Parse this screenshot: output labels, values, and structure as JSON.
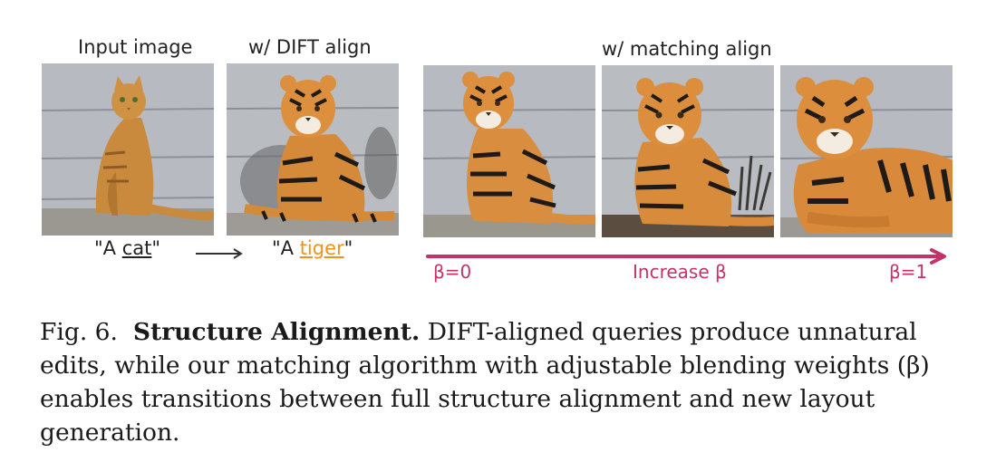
{
  "figure": {
    "headers": {
      "input": "Input image",
      "dift": "w/ DIFT align",
      "matching": "w/ matching align"
    },
    "prompts": {
      "source_prefix": "\"A ",
      "source_word": "cat",
      "source_suffix": "\"",
      "target_prefix": "\"A ",
      "target_word": "tiger",
      "target_suffix": "\""
    },
    "beta_axis": {
      "start": "β=0",
      "middle": "Increase β",
      "end": "β=1"
    },
    "colors": {
      "accent_pink": "#c2336a",
      "accent_orange": "#f0921e"
    },
    "panels": [
      {
        "name": "input-cat-image",
        "subject": "cat"
      },
      {
        "name": "dift-tiger-image",
        "subject": "tiger"
      },
      {
        "name": "matching-tiger-beta0-image",
        "subject": "tiger"
      },
      {
        "name": "matching-tiger-beta-mid-image",
        "subject": "tiger"
      },
      {
        "name": "matching-tiger-beta1-image",
        "subject": "tiger"
      }
    ]
  },
  "caption": {
    "label": "Fig. 6.",
    "title": "Structure Alignment.",
    "text": "DIFT-aligned queries produce unnatural edits, while our matching algorithm with adjustable blending weights (β) enables transitions between full structure alignment and new layout generation."
  }
}
